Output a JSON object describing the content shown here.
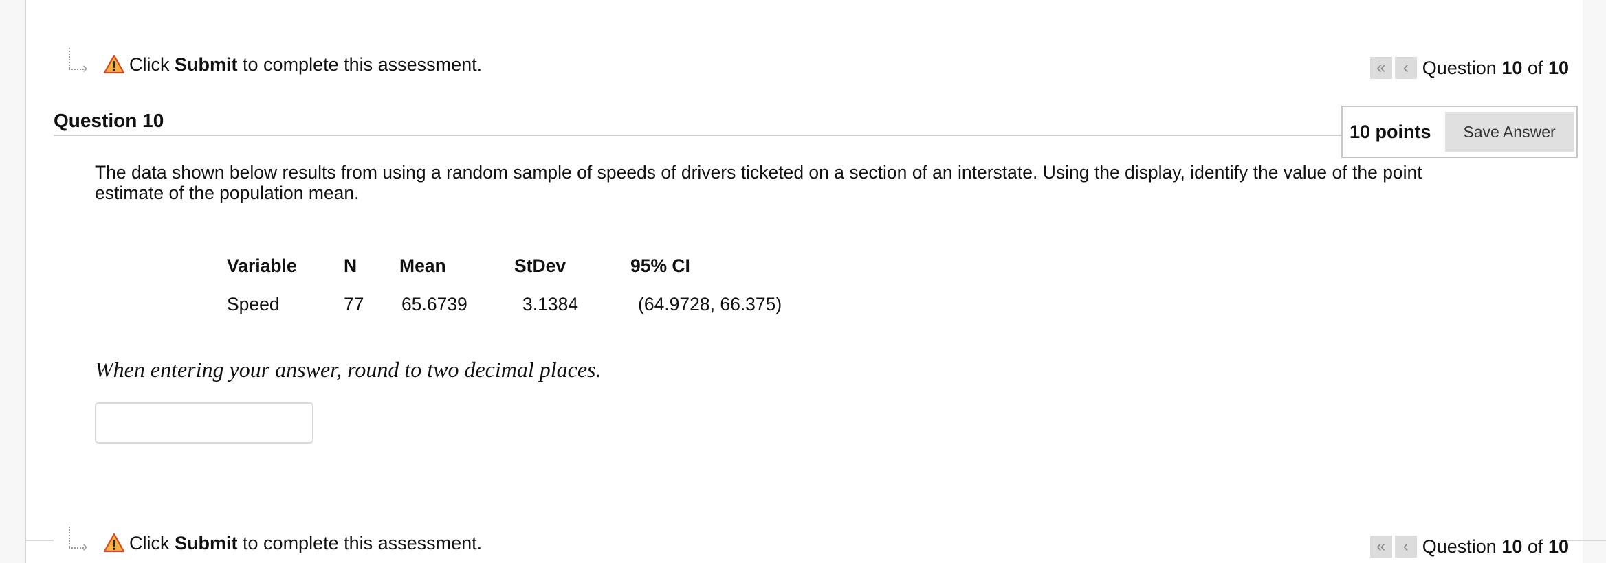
{
  "submit_notice": {
    "prefix": "Click",
    "action": "Submit",
    "suffix": "to complete this assessment."
  },
  "question_nav": {
    "label": "Question",
    "current": "10",
    "of_label": "of",
    "total": "10"
  },
  "question": {
    "title": "Question 10",
    "points": "10 points",
    "save_label": "Save Answer",
    "text": "The data shown below results from using a random sample of speeds of drivers ticketed on a section of an interstate. Using the display, identify the value of the point estimate of the population mean.",
    "instruction": "When entering your answer, round to two decimal places.",
    "answer_value": ""
  },
  "stats_table": {
    "headers": [
      "Variable",
      "N",
      "Mean",
      "StDev",
      "95% CI"
    ],
    "row": [
      "Speed",
      "77",
      "65.6739",
      "3.1384",
      "(64.9728, 66.375)"
    ]
  },
  "icons": {
    "warning": "warning-icon",
    "first": "double-chevron-left-icon",
    "prev": "chevron-left-icon"
  },
  "colors": {
    "warning_fill": "#f5a623",
    "warning_stroke": "#d0021b"
  }
}
